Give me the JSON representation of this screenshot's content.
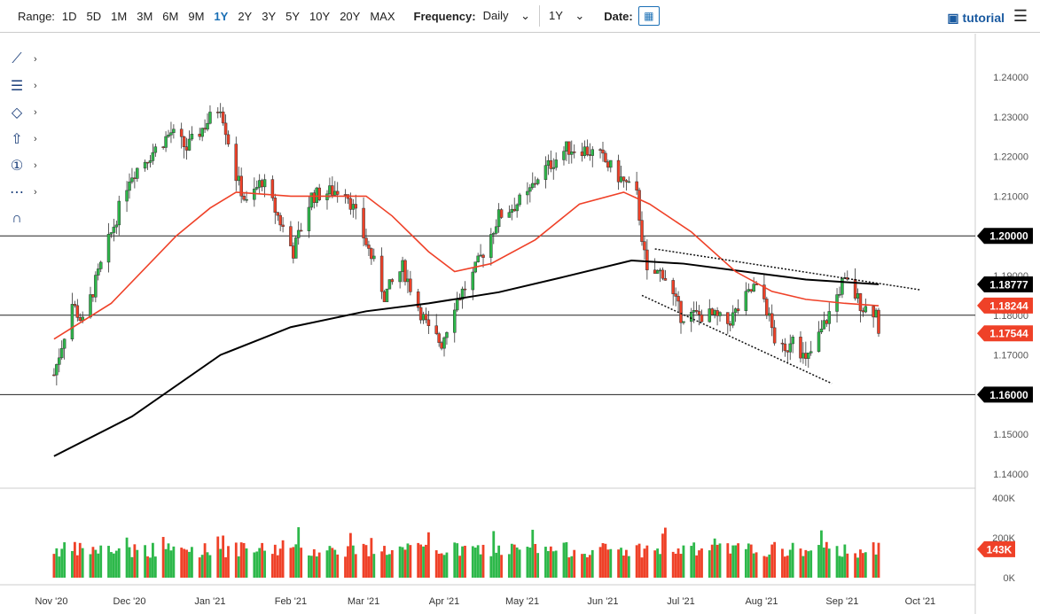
{
  "toolbar": {
    "range_label": "Range:",
    "ranges": [
      "1D",
      "5D",
      "1M",
      "3M",
      "6M",
      "9M",
      "1Y",
      "2Y",
      "3Y",
      "5Y",
      "10Y",
      "20Y",
      "MAX"
    ],
    "active_range": "1Y",
    "frequency_label": "Frequency:",
    "frequency": "Daily",
    "period": "1Y",
    "date_label": "Date:",
    "tutorial": "tutorial"
  },
  "left_tools": [
    "line-tool-icon",
    "fib-tool-icon",
    "shape-tool-icon",
    "arrow-tool-icon",
    "annotation-tool-icon",
    "pattern-tool-icon",
    "magnet-icon"
  ],
  "colors": {
    "up": "#2db84a",
    "down": "#ef4128",
    "ma50": "#ef4128",
    "ma200": "#000000"
  },
  "chart_data": {
    "type": "candlestick",
    "price_axis": {
      "ticks": [
        "1.24000",
        "1.23000",
        "1.22000",
        "1.21000",
        "1.20000",
        "1.19000",
        "1.18000",
        "1.17000",
        "1.16000",
        "1.15000",
        "1.14000"
      ],
      "range": [
        1.135,
        1.245
      ]
    },
    "volume_axis": {
      "ticks": [
        "400K",
        "200K",
        "0K"
      ],
      "range": [
        0,
        400000
      ]
    },
    "x_ticks": [
      "Nov '20",
      "Dec '20",
      "Jan '21",
      "Feb '21",
      "Mar '21",
      "Apr '21",
      "May '21",
      "Jun '21",
      "Jul '21",
      "Aug '21",
      "Sep '21",
      "Oct '21"
    ],
    "close_path": [
      [
        "2020-11-02",
        1.165
      ],
      [
        "2020-11-09",
        1.183
      ],
      [
        "2020-11-13",
        1.178
      ],
      [
        "2020-12-01",
        1.215
      ],
      [
        "2020-12-17",
        1.226
      ],
      [
        "2020-12-23",
        1.222
      ],
      [
        "2021-01-05",
        1.233
      ],
      [
        "2021-01-11",
        1.215
      ],
      [
        "2021-01-15",
        1.208
      ],
      [
        "2021-01-21",
        1.214
      ],
      [
        "2021-01-27",
        1.205
      ],
      [
        "2021-02-02",
        1.196
      ],
      [
        "2021-02-09",
        1.21
      ],
      [
        "2021-02-22",
        1.212
      ],
      [
        "2021-03-05",
        1.193
      ],
      [
        "2021-03-09",
        1.185
      ],
      [
        "2021-03-16",
        1.192
      ],
      [
        "2021-03-26",
        1.176
      ],
      [
        "2021-03-31",
        1.173
      ],
      [
        "2021-04-05",
        1.183
      ],
      [
        "2021-04-12",
        1.19
      ],
      [
        "2021-04-22",
        1.205
      ],
      [
        "2021-05-03",
        1.21
      ],
      [
        "2021-05-07",
        1.215
      ],
      [
        "2021-05-18",
        1.222
      ],
      [
        "2021-05-24",
        1.222
      ],
      [
        "2021-05-31",
        1.22
      ],
      [
        "2021-06-07",
        1.215
      ],
      [
        "2021-06-14",
        1.21
      ],
      [
        "2021-06-16",
        1.2
      ],
      [
        "2021-06-18",
        1.19
      ],
      [
        "2021-06-24",
        1.191
      ],
      [
        "2021-07-01",
        1.18
      ],
      [
        "2021-07-12",
        1.18
      ],
      [
        "2021-07-19",
        1.178
      ],
      [
        "2021-07-29",
        1.187
      ],
      [
        "2021-08-02",
        1.184
      ],
      [
        "2021-08-06",
        1.174
      ],
      [
        "2021-08-10",
        1.17
      ],
      [
        "2021-08-13",
        1.176
      ],
      [
        "2021-08-18",
        1.168
      ],
      [
        "2021-08-24",
        1.176
      ],
      [
        "2021-09-01",
        1.188
      ],
      [
        "2021-09-03",
        1.188
      ],
      [
        "2021-09-09",
        1.182
      ],
      [
        "2021-09-14",
        1.181
      ],
      [
        "2021-09-15",
        1.1754
      ]
    ],
    "ma50": [
      [
        "2020-11-02",
        1.174
      ],
      [
        "2020-11-24",
        1.183
      ],
      [
        "2020-12-19",
        1.2
      ],
      [
        "2021-01-01",
        1.207
      ],
      [
        "2021-01-11",
        1.211
      ],
      [
        "2021-02-01",
        1.21
      ],
      [
        "2021-03-02",
        1.21
      ],
      [
        "2021-03-12",
        1.205
      ],
      [
        "2021-03-26",
        1.196
      ],
      [
        "2021-04-05",
        1.191
      ],
      [
        "2021-04-19",
        1.193
      ],
      [
        "2021-05-06",
        1.199
      ],
      [
        "2021-05-23",
        1.208
      ],
      [
        "2021-06-09",
        1.211
      ],
      [
        "2021-06-19",
        1.208
      ],
      [
        "2021-07-05",
        1.201
      ],
      [
        "2021-07-22",
        1.191
      ],
      [
        "2021-08-05",
        1.186
      ],
      [
        "2021-08-18",
        1.184
      ],
      [
        "2021-09-02",
        1.183
      ],
      [
        "2021-09-15",
        1.1824
      ]
    ],
    "ma200": [
      [
        "2020-11-02",
        1.1445
      ],
      [
        "2020-12-02",
        1.1545
      ],
      [
        "2021-01-05",
        1.17
      ],
      [
        "2021-02-01",
        1.177
      ],
      [
        "2021-03-02",
        1.181
      ],
      [
        "2021-03-26",
        1.183
      ],
      [
        "2021-04-22",
        1.1858
      ],
      [
        "2021-05-16",
        1.1895
      ],
      [
        "2021-06-12",
        1.1938
      ],
      [
        "2021-07-02",
        1.193
      ],
      [
        "2021-07-29",
        1.1907
      ],
      [
        "2021-08-18",
        1.189
      ],
      [
        "2021-09-15",
        1.1878
      ]
    ],
    "trendlines": [
      [
        [
          "2021-06-21",
          1.1967
        ],
        [
          "2021-10-01",
          1.1864
        ]
      ],
      [
        [
          "2021-06-16",
          1.185
        ],
        [
          "2021-08-28",
          1.1628
        ]
      ]
    ],
    "horizontal_lines": [
      1.2,
      1.18,
      1.16
    ],
    "price_labels": [
      {
        "text": "1.20000",
        "value": 1.2,
        "color": "#000000"
      },
      {
        "text": "1.18777",
        "value": 1.18777,
        "color": "#000000"
      },
      {
        "text": "1.18244",
        "value": 1.18244,
        "color": "#ef4128"
      },
      {
        "text": "1.17544",
        "value": 1.17544,
        "color": "#ef4128"
      },
      {
        "text": "1.16000",
        "value": 1.16,
        "color": "#000000"
      }
    ],
    "volume_label": {
      "text": "143K",
      "value": 143000
    }
  }
}
